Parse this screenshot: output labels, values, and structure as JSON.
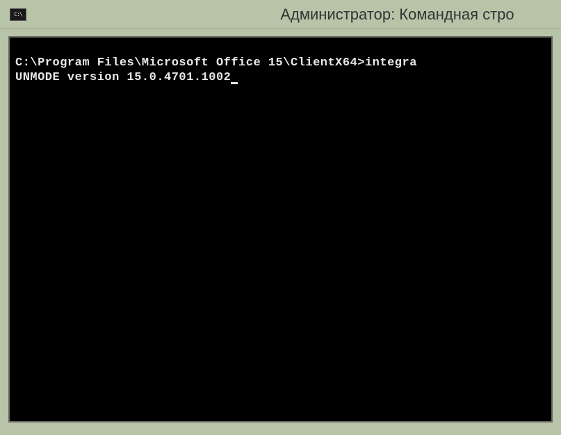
{
  "window": {
    "title": "Администратор: Командная стро",
    "icon_label": "C:\\"
  },
  "console": {
    "prompt_path": "C:\\Program Files\\Microsoft Office 15\\ClientX64>",
    "command_partial": "integra",
    "output_line": "UNMODE version 15.0.4701.1002"
  }
}
